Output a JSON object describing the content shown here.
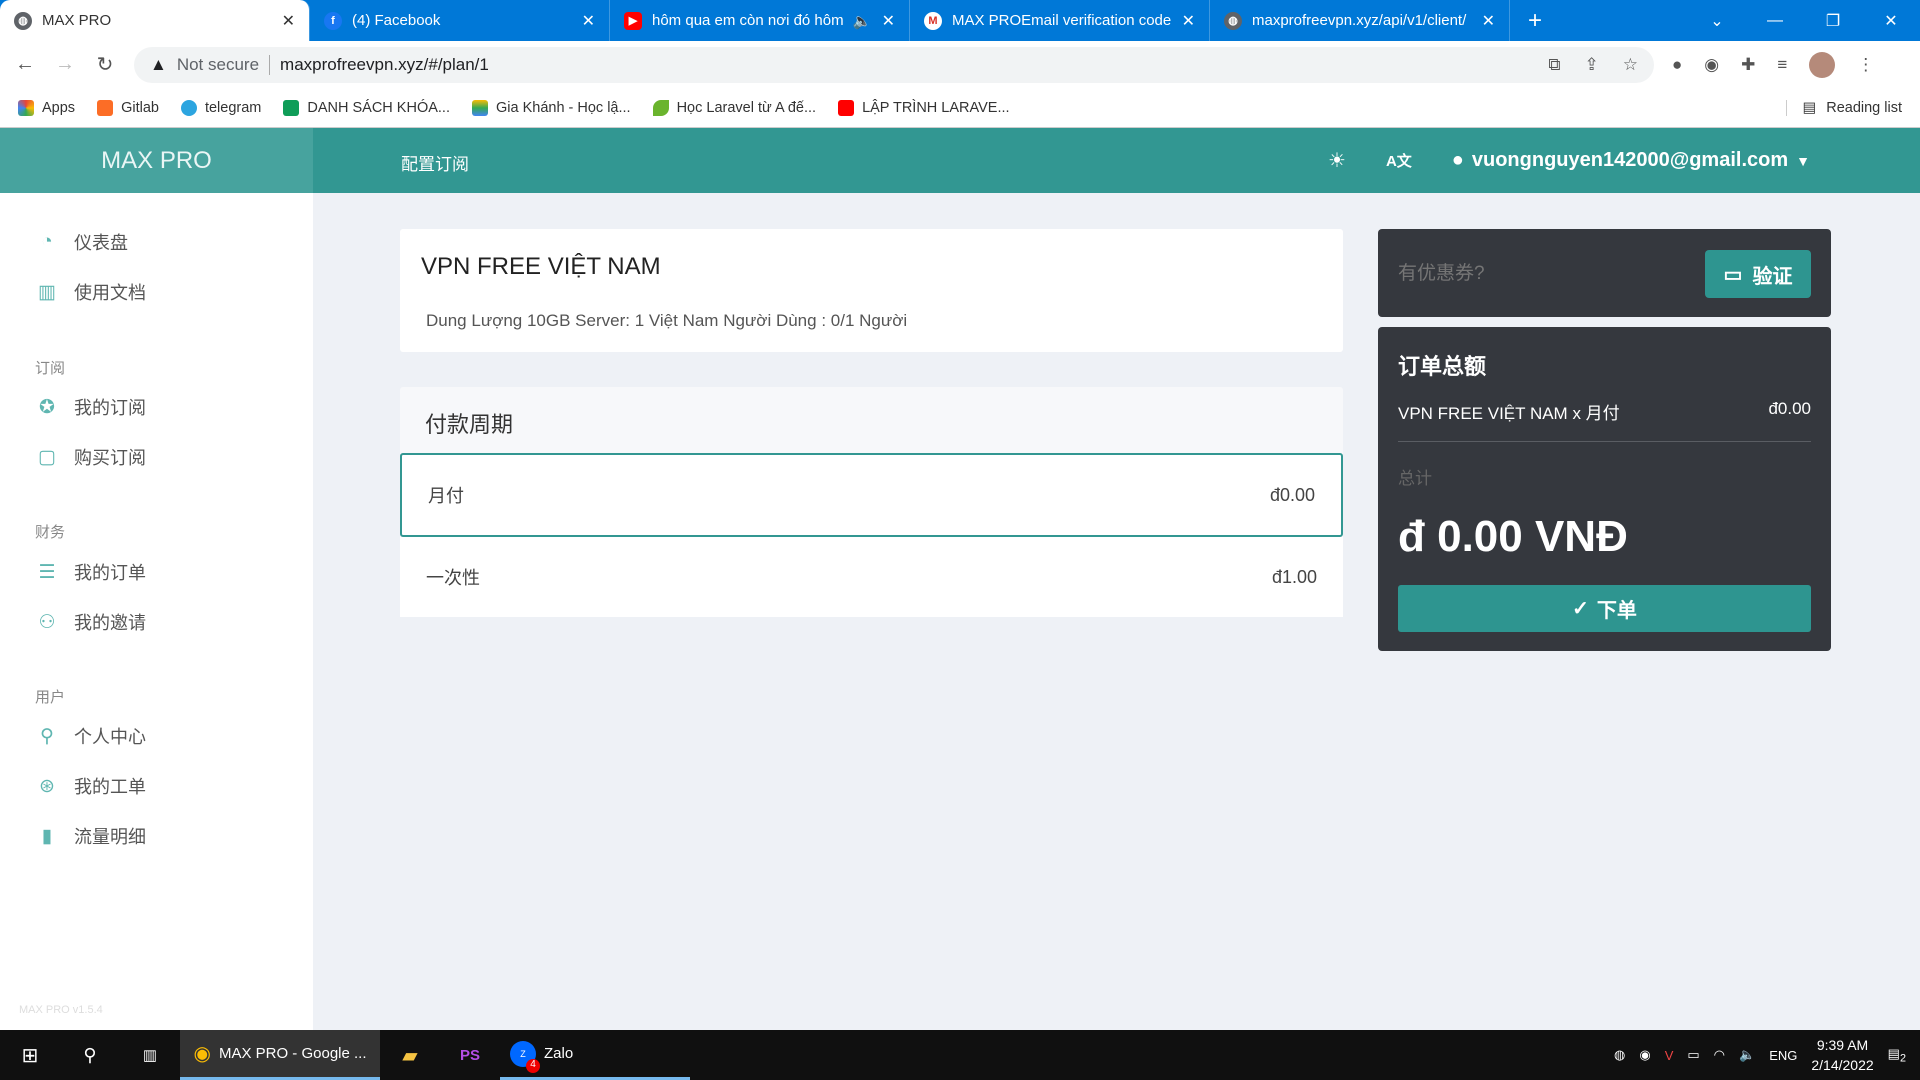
{
  "browser": {
    "tabs": [
      {
        "title": "MAX PRO",
        "icon": "globe-icon",
        "active": true
      },
      {
        "title": "(4) Facebook",
        "icon": "facebook-icon"
      },
      {
        "title": "hôm qua em còn nơi đó hôm",
        "icon": "youtube-icon"
      },
      {
        "title": "MAX PROEmail verification code",
        "icon": "gmail-icon"
      },
      {
        "title": "maxprofreevpn.xyz/api/v1/client/",
        "icon": "globe-icon"
      }
    ],
    "security": "Not secure",
    "url": "maxprofreevpn.xyz/#/plan/1",
    "bookmarks": [
      "Apps",
      "Gitlab",
      "telegram",
      "DANH SÁCH KHÓA...",
      "Gia Khánh - Học lậ...",
      "Học Laravel từ A đế...",
      "LẬP TRÌNH LARAVE..."
    ],
    "reading_list": "Reading list"
  },
  "app": {
    "brand": "MAX PRO",
    "breadcrumb": "配置订阅",
    "user_email": "vuongnguyen142000@gmail.com",
    "version": "MAX PRO v1.5.4"
  },
  "sidebar": {
    "items": [
      {
        "label": "仪表盘",
        "icon": "dashboard-icon"
      },
      {
        "label": "使用文档",
        "icon": "book-icon"
      },
      {
        "label": "我的订阅",
        "icon": "award-icon"
      },
      {
        "label": "购买订阅",
        "icon": "bag-icon"
      },
      {
        "label": "我的订单",
        "icon": "list-icon"
      },
      {
        "label": "我的邀请",
        "icon": "users-icon"
      },
      {
        "label": "个人中心",
        "icon": "user-icon"
      },
      {
        "label": "我的工单",
        "icon": "lifebuoy-icon"
      },
      {
        "label": "流量明细",
        "icon": "bar-chart-icon"
      }
    ],
    "sections": [
      "订阅",
      "财务",
      "用户"
    ]
  },
  "plan": {
    "title": "VPN FREE VIỆT NAM",
    "description": "Dung Lượng 10GB Server: 1 Việt Nam Người Dùng : 0/1 Người",
    "cycle_heading": "付款周期",
    "cycles": [
      {
        "label": "月付",
        "price": "đ0.00",
        "selected": true
      },
      {
        "label": "一次性",
        "price": "đ1.00",
        "selected": false
      }
    ]
  },
  "coupon": {
    "placeholder": "有优惠券?",
    "button": "验证"
  },
  "order": {
    "title": "订单总额",
    "line_label": "VPN FREE VIỆT NAM x 月付",
    "line_price": "đ0.00",
    "total_label": "总计",
    "total": "đ 0.00 VNĐ",
    "button": "下单"
  },
  "taskbar": {
    "chrome": "MAX PRO - Google ...",
    "zalo": "Zalo",
    "zalo_badge": "4",
    "lang": "ENG",
    "time": "9:39 AM",
    "date": "2/14/2022",
    "notif": "2"
  },
  "colors": {
    "accent": "#329792",
    "dark_card": "#35383e"
  }
}
